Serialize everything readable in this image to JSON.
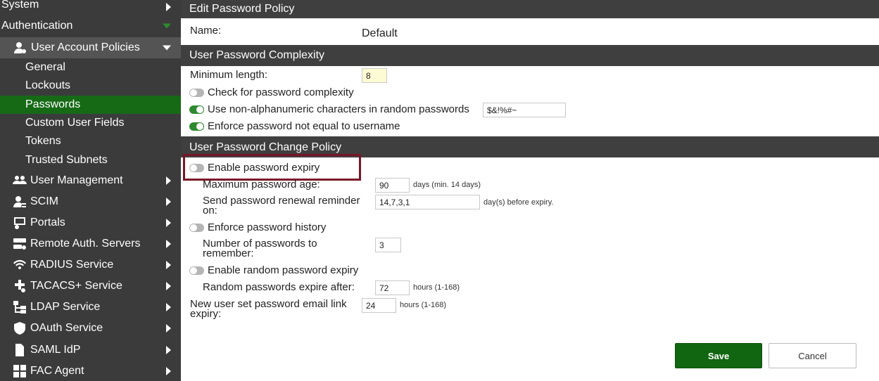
{
  "sidebar": {
    "system": "System",
    "authentication": "Authentication",
    "user_account_policies": "User Account Policies",
    "sub_items": [
      "General",
      "Lockouts",
      "Passwords",
      "Custom User Fields",
      "Tokens",
      "Trusted Subnets"
    ],
    "active_sub_item": "Passwords",
    "main_items": [
      {
        "label": "User Management",
        "icon": "users-icon"
      },
      {
        "label": "SCIM",
        "icon": "user-sync-icon"
      },
      {
        "label": "Portals",
        "icon": "portal-icon"
      },
      {
        "label": "Remote Auth. Servers",
        "icon": "server-icon"
      },
      {
        "label": "RADIUS Service",
        "icon": "radius-wifi-icon"
      },
      {
        "label": "TACACS+ Service",
        "icon": "tacacs-icon"
      },
      {
        "label": "LDAP Service",
        "icon": "ldap-tree-icon"
      },
      {
        "label": "OAuth Service",
        "icon": "shield-icon"
      },
      {
        "label": "SAML IdP",
        "icon": "document-icon"
      },
      {
        "label": "FAC Agent",
        "icon": "agent-icon"
      }
    ]
  },
  "page": {
    "title": "Edit Password Policy",
    "name_label": "Name:",
    "name_value": "Default",
    "complexity_header": "User Password Complexity",
    "min_length_label": "Minimum length:",
    "min_length_value": "8",
    "check_complexity_label": "Check for password complexity",
    "check_complexity_on": false,
    "non_alnum_label": "Use non-alphanumeric characters in random passwords",
    "non_alnum_on": true,
    "non_alnum_value": "$&!%#~",
    "not_equal_username_label": "Enforce password not equal to username",
    "not_equal_username_on": true,
    "change_policy_header": "User Password Change Policy",
    "enable_expiry_label": "Enable password expiry",
    "enable_expiry_on": false,
    "max_age_label": "Maximum password age:",
    "max_age_value": "90",
    "max_age_hint": "days (min. 14 days)",
    "renewal_reminder_label": "Send password renewal reminder on:",
    "renewal_reminder_value": "14,7,3,1",
    "renewal_reminder_hint": "day(s) before expiry.",
    "history_label": "Enforce password history",
    "history_on": false,
    "num_remember_label": "Number of passwords to remember:",
    "num_remember_value": "3",
    "random_expiry_label": "Enable random password expiry",
    "random_expiry_on": false,
    "random_expire_after_label": "Random passwords expire after:",
    "random_expire_after_value": "72",
    "random_expire_after_hint": "hours (1-168)",
    "email_link_label": "New user set password email link expiry:",
    "email_link_value": "24",
    "email_link_hint": "hours (1-168)"
  },
  "buttons": {
    "save": "Save",
    "cancel": "Cancel"
  },
  "colors": {
    "sidebar_bg": "#3b3b3b",
    "active_green": "#166a16",
    "header_bg": "#3f3f3f",
    "highlight_border": "#7a1528"
  }
}
